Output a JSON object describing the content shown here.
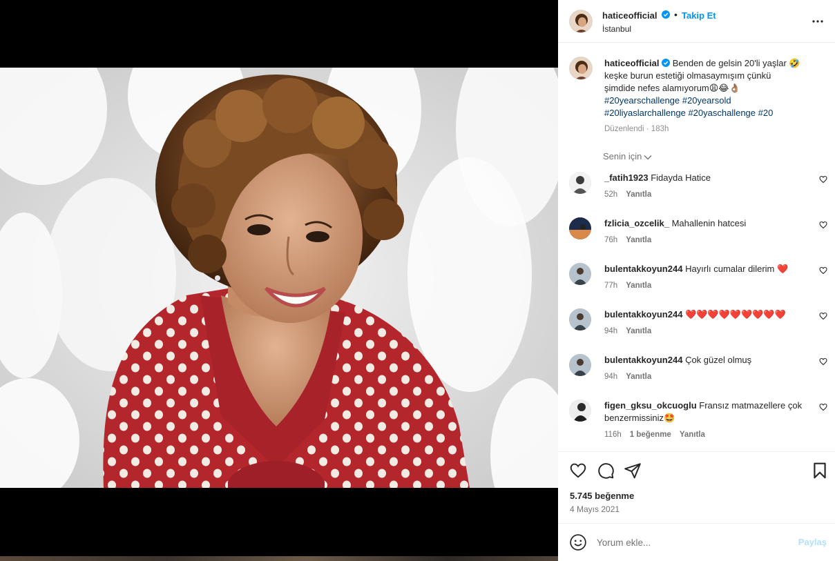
{
  "post": {
    "author": "haticeofficial",
    "follow_label": "Takip Et",
    "separator": "•",
    "location": "İstanbul",
    "caption_line1": "Benden de gelsin 20'li yaşlar 🤣",
    "caption_line2": "keşke burun estetiği olmasaymışım çünkü",
    "caption_line3": "şimdide nefes alamıyorum😩😂👌🏽",
    "hashtags_line1_a": "#20yearschallenge",
    "hashtags_line1_b": "#20yearsold",
    "hashtags_line2_a": "#20liyaslarchallenge",
    "hashtags_line2_b": "#20yaschallenge",
    "hashtags_line2_c": "#20",
    "edited_label": "Düzenlendi",
    "meta_sep": "·",
    "time": "183h"
  },
  "for_you_label": "Senin için",
  "comments": [
    {
      "user": "_fatih1923",
      "text": "Fidayda Hatice",
      "time": "52h",
      "reply": "Yanıtla",
      "likes": ""
    },
    {
      "user": "fzlicia_ozcelik_",
      "text": "Mahallenin hatcesi",
      "time": "76h",
      "reply": "Yanıtla",
      "likes": ""
    },
    {
      "user": "bulentakkoyun244",
      "text": "Hayırlı cumalar dilerim ❤️",
      "time": "77h",
      "reply": "Yanıtla",
      "likes": ""
    },
    {
      "user": "bulentakkoyun244",
      "text": "❤️❤️❤️❤️❤️❤️❤️❤️❤️",
      "time": "94h",
      "reply": "Yanıtla",
      "likes": ""
    },
    {
      "user": "bulentakkoyun244",
      "text": "Çok güzel olmuş",
      "time": "94h",
      "reply": "Yanıtla",
      "likes": ""
    },
    {
      "user": "figen_gksu_okcuoglu",
      "text": "Fransız matmazellere çok benzermissiniz🤩",
      "time": "116h",
      "reply": "Yanıtla",
      "likes": "1 beğenme"
    }
  ],
  "likes_label": "5.745 beğenme",
  "date_label": "4 Mayıs 2021",
  "comment_box": {
    "placeholder": "Yorum ekle...",
    "share_label": "Paylaş"
  },
  "colors": {
    "accent": "#0095f6",
    "hashtag": "#00376b",
    "muted": "#737373",
    "share_disabled": "#b2dffc",
    "heart_red": "#ed1c24",
    "dress_red": "#b3262c"
  },
  "icons": [
    "verified-badge-icon",
    "more-options-icon",
    "chevron-down-icon",
    "heart-icon",
    "comment-icon",
    "share-icon",
    "bookmark-icon",
    "emoji-icon"
  ]
}
